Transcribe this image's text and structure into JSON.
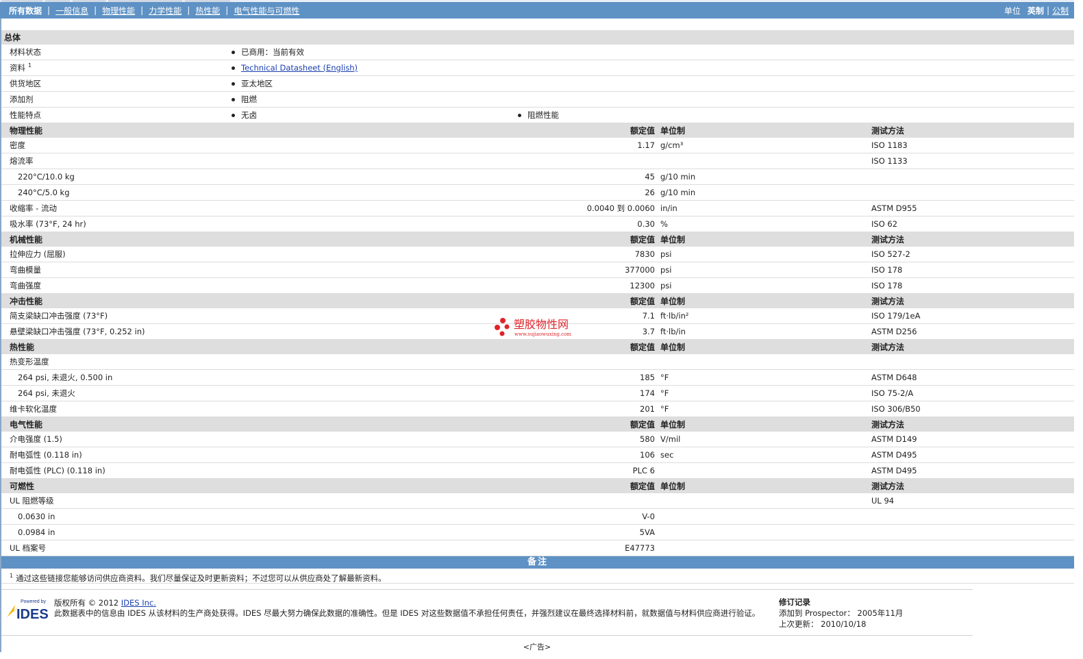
{
  "nav": {
    "tabs": [
      "所有数据",
      "一般信息",
      "物理性能",
      "力学性能",
      "热性能",
      "电气性能与可燃性"
    ],
    "units_label": "单位",
    "units_english": "英制",
    "units_metric": "公制"
  },
  "general": {
    "title": "总体",
    "rows": [
      {
        "label": "材料状态",
        "values": [
          "已商用：当前有效"
        ]
      },
      {
        "label": "资料",
        "sup": "1",
        "values": [
          "Technical Datasheet (English)"
        ]
      },
      {
        "label": "供货地区",
        "values": [
          "亚太地区"
        ]
      },
      {
        "label": "添加剂",
        "values": [
          "阻燃"
        ]
      },
      {
        "label": "性能特点",
        "values": [
          "无卤",
          "阻燃性能"
        ]
      }
    ]
  },
  "headers": {
    "value": "额定值",
    "unit": "单位制",
    "method": "测试方法"
  },
  "sections": [
    {
      "title": "物理性能",
      "rows": [
        {
          "label": "密度",
          "value": "1.17",
          "unit": "g/cm³",
          "method": "ISO 1183"
        },
        {
          "label": "熔流率",
          "value": "",
          "unit": "",
          "method": "ISO 1133"
        },
        {
          "label": "220°C/10.0 kg",
          "sub": true,
          "value": "45",
          "unit": "g/10 min",
          "method": ""
        },
        {
          "label": "240°C/5.0 kg",
          "sub": true,
          "value": "26",
          "unit": "g/10 min",
          "method": ""
        },
        {
          "label": "收缩率 - 流动",
          "value": "0.0040 到 0.0060",
          "unit": "in/in",
          "method": "ASTM D955"
        },
        {
          "label": "吸水率 (73°F, 24 hr)",
          "value": "0.30",
          "unit": "%",
          "method": "ISO 62"
        }
      ]
    },
    {
      "title": "机械性能",
      "rows": [
        {
          "label": "拉伸应力 (屈服)",
          "value": "7830",
          "unit": "psi",
          "method": "ISO 527-2"
        },
        {
          "label": "弯曲模量",
          "value": "377000",
          "unit": "psi",
          "method": "ISO 178"
        },
        {
          "label": "弯曲强度",
          "value": "12300",
          "unit": "psi",
          "method": "ISO 178"
        }
      ]
    },
    {
      "title": "冲击性能",
      "rows": [
        {
          "label": "简支梁缺口冲击强度 (73°F)",
          "value": "7.1",
          "unit": "ft·lb/in²",
          "method": "ISO 179/1eA"
        },
        {
          "label": "悬壁梁缺口冲击强度 (73°F, 0.252 in)",
          "value": "3.7",
          "unit": "ft·lb/in",
          "method": "ASTM D256"
        }
      ]
    },
    {
      "title": "热性能",
      "rows": [
        {
          "label": "热变形温度",
          "value": "",
          "unit": "",
          "method": ""
        },
        {
          "label": "264 psi, 未退火, 0.500 in",
          "sub": true,
          "value": "185",
          "unit": "°F",
          "method": "ASTM D648"
        },
        {
          "label": "264 psi, 未退火",
          "sub": true,
          "value": "174",
          "unit": "°F",
          "method": "ISO 75-2/A"
        },
        {
          "label": "维卡软化温度",
          "value": "201",
          "unit": "°F",
          "method": "ISO 306/B50"
        }
      ]
    },
    {
      "title": "电气性能",
      "rows": [
        {
          "label": "介电强度 (1.5)",
          "value": "580",
          "unit": "V/mil",
          "method": "ASTM D149"
        },
        {
          "label": "耐电弧性 (0.118 in)",
          "value": "106",
          "unit": "sec",
          "method": "ASTM D495"
        },
        {
          "label": "耐电弧性 (PLC) (0.118 in)",
          "value": "PLC 6",
          "unit": "",
          "method": "ASTM D495"
        }
      ]
    },
    {
      "title": "可燃性",
      "rows": [
        {
          "label": "UL 阻燃等级",
          "value": "",
          "unit": "",
          "method": "UL 94"
        },
        {
          "label": "0.0630 in",
          "sub": true,
          "value": "V-0",
          "unit": "",
          "method": ""
        },
        {
          "label": "0.0984 in",
          "sub": true,
          "value": "5VA",
          "unit": "",
          "method": ""
        },
        {
          "label": "UL 档案号",
          "value": "E47773",
          "unit": "",
          "method": ""
        }
      ]
    }
  ],
  "notes": {
    "title": "备注",
    "sup": "1",
    "text": "通过这些链接您能够访问供应商资料。我们尽量保证及时更新资料；不过您可以从供应商处了解最新资料。"
  },
  "footer": {
    "logo_small": "Powered by",
    "logo_text": "IDES",
    "copyright_prefix": "版权所有 © 2012",
    "copyright_link": "IDES Inc.",
    "disclaimer": "此数据表中的信息由 IDES 从该材料的生产商处获得。IDES 尽最大努力确保此数据的准确性。但是 IDES 对这些数据值不承担任何责任，并强烈建议在最终选择材料前，就数据值与材料供应商进行验证。",
    "rev_title": "修订记录",
    "added_label": "添加到 Prospector：",
    "added_value": "2005年11月",
    "updated_label": "上次更新：",
    "updated_value": "2010/10/18"
  },
  "ad_label": "<广告>",
  "watermark": {
    "text": "塑胶物性网",
    "url": "www.sujiaowuxing.com",
    "color": "#e0242a"
  }
}
